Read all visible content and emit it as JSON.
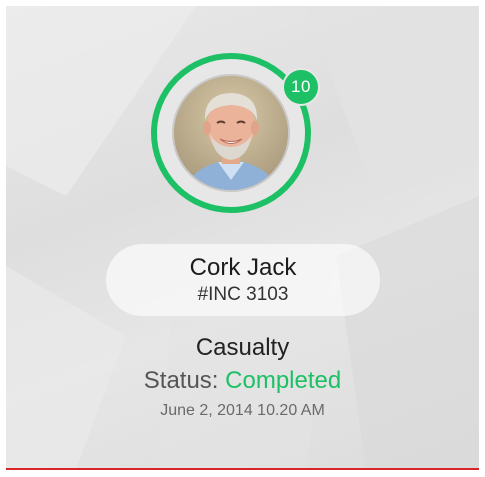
{
  "card": {
    "avatar_icon": "person-photo",
    "badge_count": "10",
    "name": "Cork Jack",
    "incident_id": "#INC 3103",
    "category": "Casualty",
    "status_label": "Status:",
    "status_value": "Completed",
    "datetime": "June 2, 2014 10.20 AM"
  },
  "colors": {
    "accent_green": "#1ec066",
    "divider_red": "#d8252b",
    "card_background": "#e3e3e3"
  }
}
